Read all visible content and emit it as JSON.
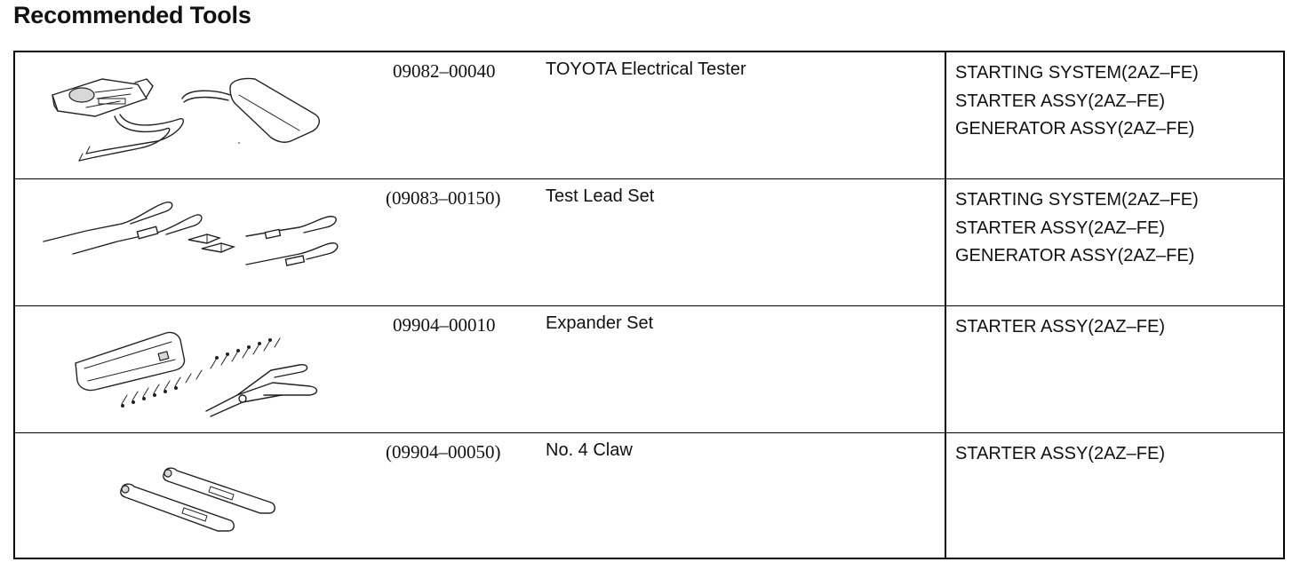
{
  "page": {
    "title": "Recommended Tools"
  },
  "tools": [
    {
      "part_no": "09082–00040",
      "name": "TOYOTA Electrical Tester",
      "illustration_icon": "electrical-tester-illustration",
      "usage": [
        "STARTING SYSTEM(2AZ–FE)",
        "STARTER ASSY(2AZ–FE)",
        "GENERATOR ASSY(2AZ–FE)"
      ]
    },
    {
      "part_no": "(09083–00150)",
      "name": "Test Lead Set",
      "illustration_icon": "test-lead-set-illustration",
      "usage": [
        "STARTING SYSTEM(2AZ–FE)",
        "STARTER ASSY(2AZ–FE)",
        "GENERATOR ASSY(2AZ–FE)"
      ]
    },
    {
      "part_no": "09904–00010",
      "name": "Expander Set",
      "illustration_icon": "expander-set-illustration",
      "usage": [
        "STARTER ASSY(2AZ–FE)"
      ]
    },
    {
      "part_no": "(09904–00050)",
      "name": "No. 4 Claw",
      "illustration_icon": "claw-illustration",
      "usage": [
        "STARTER ASSY(2AZ–FE)"
      ]
    }
  ]
}
